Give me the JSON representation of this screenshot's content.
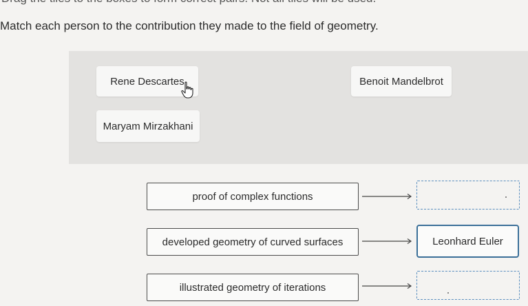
{
  "instructions": {
    "partial_line": "Drag the tiles to the boxes to form correct pairs. Not all tiles will be used.",
    "main_line": "Match each person to the contribution they made to the field of geometry."
  },
  "tile_bank": {
    "tiles": [
      "Rene Descartes",
      "Benoit Mandelbrot",
      "Maryam Mirzakhani"
    ]
  },
  "pairs": [
    {
      "prompt": "proof of complex functions",
      "answer": ""
    },
    {
      "prompt": "developed geometry of curved surfaces",
      "answer": "Leonhard Euler"
    },
    {
      "prompt": "illustrated geometry of iterations",
      "answer": ""
    }
  ],
  "colors": {
    "bank_background": "#e3e2e0",
    "drop_zone_border": "#5b8fbf",
    "filled_border": "#3a6f98"
  },
  "icons": {
    "cursor": "hand-pointer-icon",
    "arrow": "right-arrow-icon"
  }
}
